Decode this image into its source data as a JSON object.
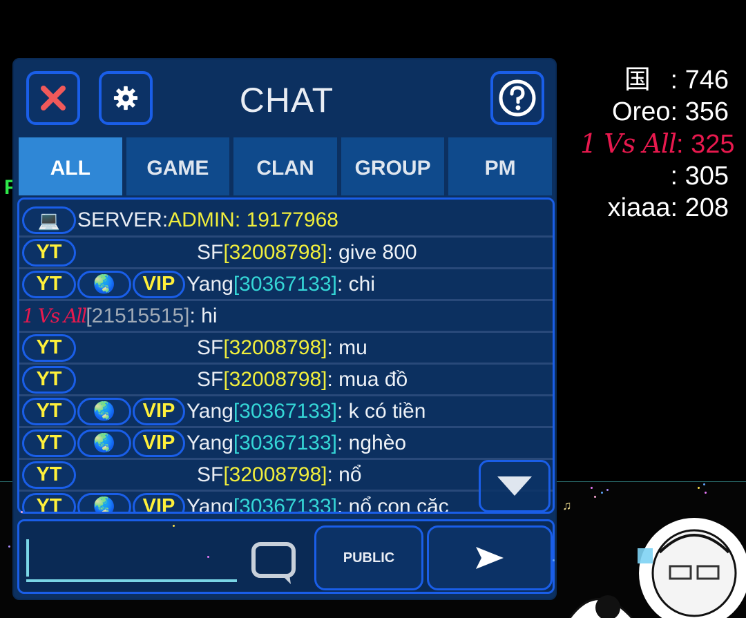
{
  "header": {
    "title": "CHAT"
  },
  "tabs": [
    {
      "label": "ALL",
      "active": true
    },
    {
      "label": "GAME",
      "active": false
    },
    {
      "label": "CLAN",
      "active": false
    },
    {
      "label": "GROUP",
      "active": false
    },
    {
      "label": "PM",
      "active": false
    }
  ],
  "messages": [
    {
      "badges": [
        "pc-icon"
      ],
      "name": "SERVER: ",
      "uid": "",
      "text": "ADMIN: 19177968",
      "type": "server"
    },
    {
      "badges": [
        "YT"
      ],
      "name": "SF",
      "uid": "[32008798]",
      "text": ": give 800",
      "type": "sf"
    },
    {
      "badges": [
        "YT",
        "globe-icon",
        "VIP"
      ],
      "name": "Yang",
      "uid": "[30367133]",
      "text": ": chi",
      "type": "yang"
    },
    {
      "badges": [],
      "name": "1 Vs All",
      "uid": "[21515515]",
      "text": ": hi",
      "type": "fancy"
    },
    {
      "badges": [
        "YT"
      ],
      "name": "SF",
      "uid": "[32008798]",
      "text": ": mu",
      "type": "sf"
    },
    {
      "badges": [
        "YT"
      ],
      "name": "SF",
      "uid": "[32008798]",
      "text": ": mua đồ",
      "type": "sf"
    },
    {
      "badges": [
        "YT",
        "globe-icon",
        "VIP"
      ],
      "name": "Yang",
      "uid": "[30367133]",
      "text": ": k có tiền",
      "type": "yang"
    },
    {
      "badges": [
        "YT",
        "globe-icon",
        "VIP"
      ],
      "name": "Yang",
      "uid": "[30367133]",
      "text": ": nghèo",
      "type": "yang"
    },
    {
      "badges": [
        "YT"
      ],
      "name": "SF",
      "uid": "[32008798]",
      "text": ": nổ",
      "type": "sf"
    },
    {
      "badges": [
        "YT",
        "globe-icon",
        "VIP"
      ],
      "name": "Yang",
      "uid": "[30367133]",
      "text": ": nổ con cặc",
      "type": "yang"
    }
  ],
  "badge_labels": {
    "yt": "YT",
    "vip": "VIP",
    "globe": "🌏",
    "pc": "💻"
  },
  "input": {
    "value": "",
    "placeholder": ""
  },
  "footer": {
    "public_label": "PUBLIC"
  },
  "leaderboard": [
    {
      "name": "国",
      "sep": " : ",
      "score": "746",
      "style": "plain"
    },
    {
      "name": "Oreo",
      "sep": ": ",
      "score": "356",
      "style": "plain"
    },
    {
      "name": "1 Vs All",
      "sep": ": ",
      "score": "325",
      "style": "fancy"
    },
    {
      "name": "",
      "sep": ": ",
      "score": "305",
      "style": "plain"
    },
    {
      "name": "xiaaa",
      "sep": ": ",
      "score": "208",
      "style": "plain"
    }
  ],
  "colors": {
    "panel": "#0c3060",
    "accent_border": "#1a5ee8",
    "active_tab": "#2f87d6",
    "badge_text": "#f0ee3c",
    "uid_cyan": "#35d7d7",
    "fancy_name": "#e8194e",
    "close_x": "#f0595a"
  },
  "icons": {
    "close": "close-icon",
    "settings": "gear-icon",
    "help": "help-icon",
    "scroll": "chevron-down-icon",
    "emoji": "chat-bubble-icon",
    "send": "send-icon"
  }
}
